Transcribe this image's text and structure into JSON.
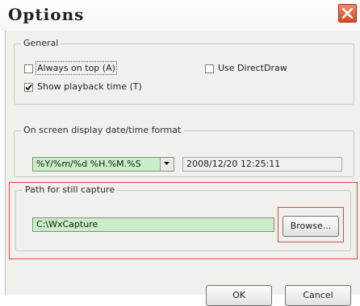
{
  "window": {
    "title": "Options"
  },
  "general": {
    "legend": "General",
    "always_on_top": {
      "label": "Always on top (A)",
      "checked": false
    },
    "use_directdraw": {
      "label": "Use DirectDraw",
      "checked": false
    },
    "show_playback_time": {
      "label": "Show playback time (T)",
      "checked": true
    }
  },
  "osd": {
    "legend": "On screen display date/time format",
    "format_value": "%Y/%m/%d %H.%M.%S",
    "preview": "2008/12/20 12:25:11"
  },
  "capture": {
    "legend": "Path for still capture",
    "path_value": "C:\\WxCapture",
    "browse_label": "Browse..."
  },
  "footer": {
    "ok_label": "OK",
    "cancel_label": "Cancel"
  },
  "colors": {
    "field_green": "#c7eec6",
    "highlight_red": "#e04848",
    "close_red": "#d94a1f"
  },
  "icons": {
    "close": "close-icon",
    "dropdown": "chevron-down-icon",
    "check": "check-icon"
  }
}
